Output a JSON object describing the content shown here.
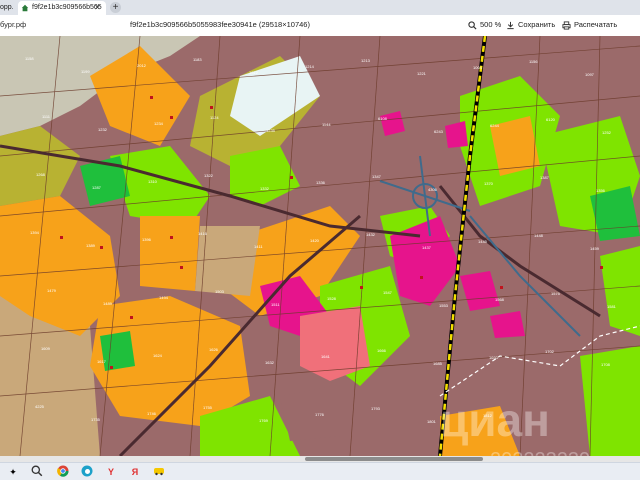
{
  "browser": {
    "tab1_label": "орр.",
    "tab2_label": "f9f2e1b3c909566b505",
    "tab_close": "✕",
    "new_tab": "+",
    "address_host": "бург.рф",
    "address_path": "f9f2e1b3c909566b5055983fee30941e (29518×10746)",
    "zoom_label": "500 %",
    "save_label": "Сохранить",
    "print_label": "Распечатать"
  },
  "map": {
    "parcel_labels": [
      "1158",
      "1199",
      "2012",
      "1183",
      "1012",
      "1214",
      "1213",
      "1221",
      "1004",
      "1156",
      "1097",
      "1111",
      "1232",
      "1234",
      "1124",
      "1235",
      "1144",
      "6108",
      "6243",
      "6244",
      "6120",
      "1252",
      "1268",
      "1287",
      "1310",
      "1322",
      "1332",
      "1336",
      "1347",
      "4306",
      "1370",
      "1387",
      "1356",
      "1394",
      "1389",
      "1396",
      "1416",
      "1411",
      "1420",
      "1432",
      "1437",
      "1445",
      "1448",
      "1459",
      "1479",
      "1489",
      "1494",
      "1503",
      "1511",
      "1528",
      "1547",
      "1553",
      "1568",
      "1575",
      "1581",
      "1609",
      "1617",
      "1624",
      "1626",
      "1632",
      "1641",
      "1666",
      "1685",
      "1693",
      "1702",
      "1708",
      "4225",
      "1735",
      "1746",
      "1755",
      "1769",
      "1776",
      "1793",
      "1801",
      "1812"
    ],
    "watermark": "циан",
    "watermark_id": "202223239"
  },
  "taskbar": {
    "icons": [
      "start-icon",
      "search-icon",
      "chrome-icon",
      "edge-icon",
      "yandex-icon",
      "yandex-browser-icon",
      "taxi-icon"
    ]
  },
  "colors": {
    "lime": "#7fe400",
    "orange": "#f7a21a",
    "magenta": "#e6148c",
    "brown": "#9b6a6a",
    "olive": "#b8b232",
    "tan": "#c9a87a",
    "green": "#1fbf3c",
    "yellow": "#f5e000"
  }
}
